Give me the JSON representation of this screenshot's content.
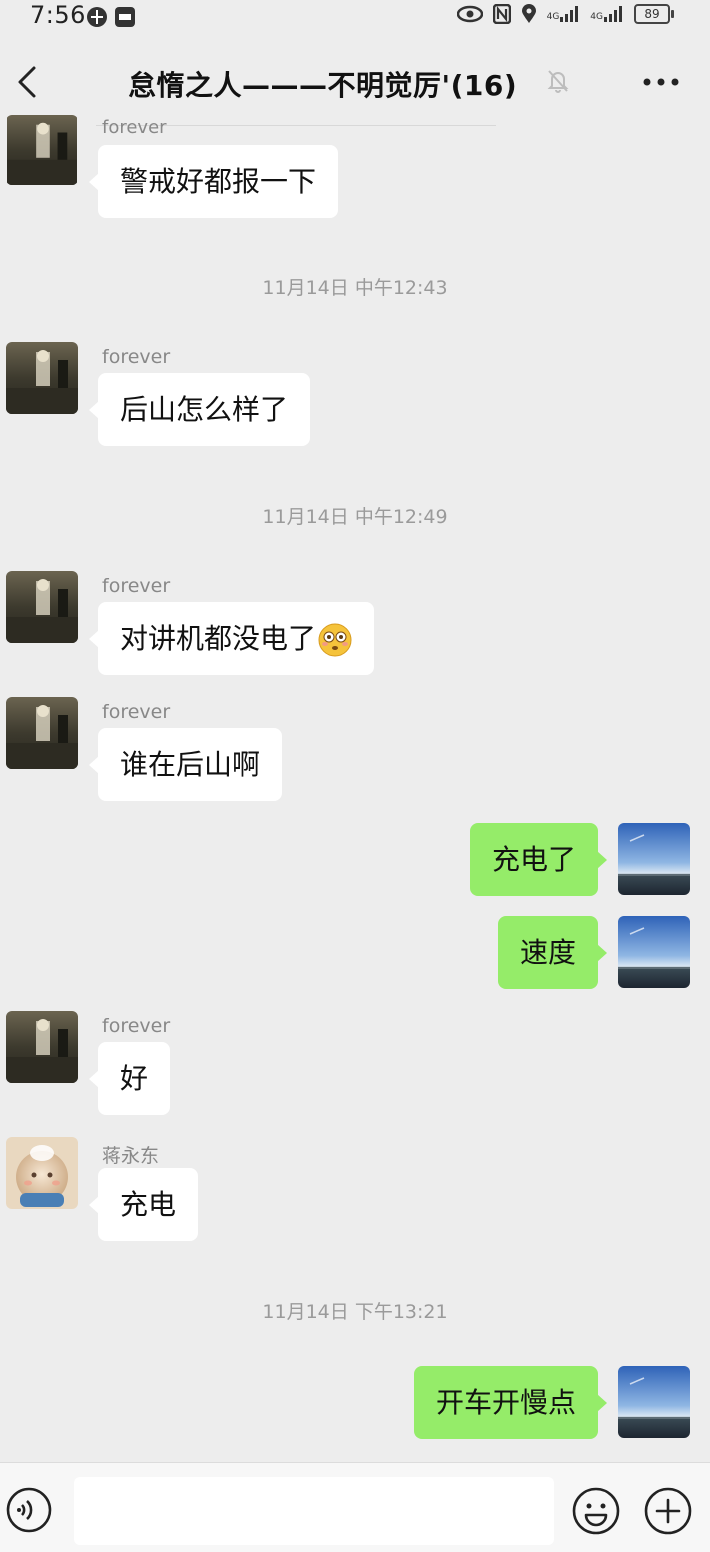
{
  "status_bar": {
    "time": "7:56",
    "network_1": "4G",
    "network_2": "4G",
    "battery": "89"
  },
  "header": {
    "title": "怠惰之人———不明觉厉'(16)",
    "back_icon": "chevron-left-icon",
    "mute_icon": "bell-off-icon",
    "more_icon": "ellipsis-icon"
  },
  "messages": [
    {
      "sender": "forever",
      "text": "警戒好都报一下"
    },
    {
      "timestamp": "11月14日 中午12:43"
    },
    {
      "sender": "forever",
      "text": "后山怎么样了"
    },
    {
      "timestamp": "11月14日 中午12:49"
    },
    {
      "sender": "forever",
      "text": "对讲机都没电了",
      "emoji": "flushed-face-emoji"
    },
    {
      "sender": "forever",
      "text": "谁在后山啊"
    },
    {
      "from_self": true,
      "text": "充电了"
    },
    {
      "from_self": true,
      "text": "速度"
    },
    {
      "sender": "forever",
      "text": "好"
    },
    {
      "sender": "蒋永东",
      "text": "充电"
    },
    {
      "timestamp": "11月14日 下午13:21"
    },
    {
      "from_self": true,
      "text": "开车开慢点"
    }
  ],
  "input_bar": {
    "voice_icon": "voice-icon",
    "input_value": "",
    "emoji_icon": "smiley-icon",
    "plus_icon": "plus-circle-icon"
  },
  "colors": {
    "background": "#ededed",
    "incoming_bubble": "#ffffff",
    "outgoing_bubble": "#95ec69",
    "timestamp_text": "#9a9a9a",
    "sender_text": "#888888"
  }
}
